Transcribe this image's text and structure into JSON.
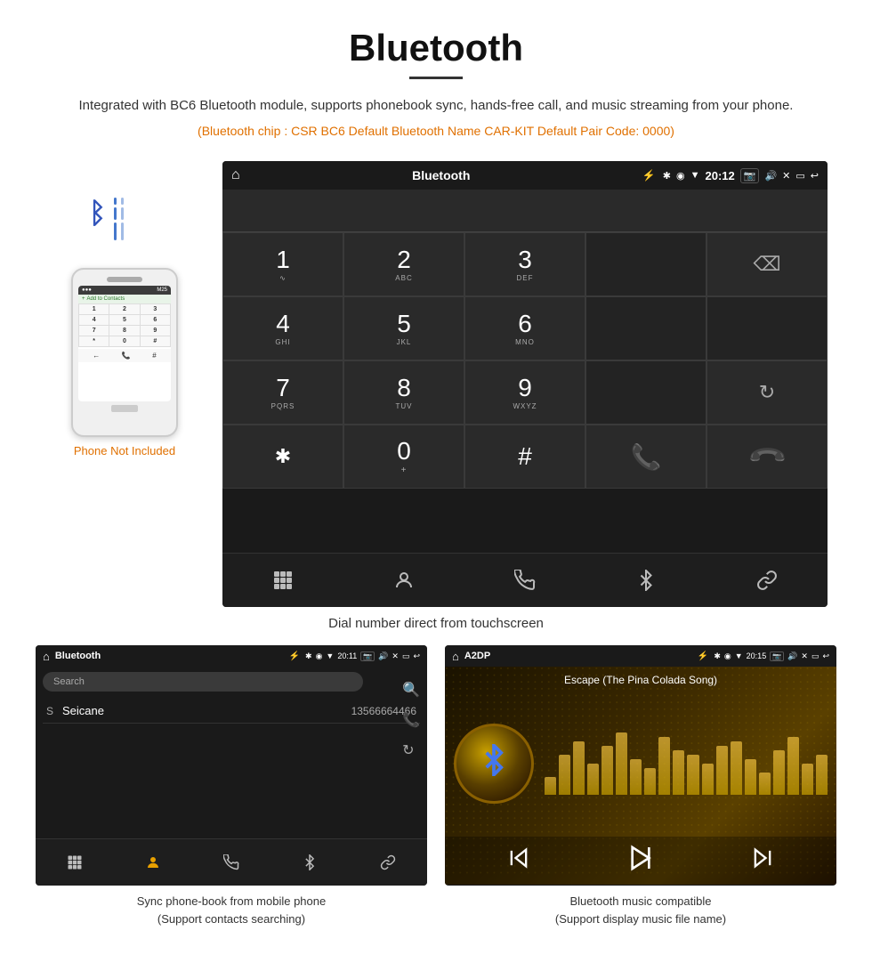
{
  "title": "Bluetooth",
  "description": "Integrated with BC6 Bluetooth module, supports phonebook sync, hands-free call, and music streaming from your phone.",
  "specs": "(Bluetooth chip : CSR BC6    Default Bluetooth Name CAR-KIT    Default Pair Code: 0000)",
  "phone_not_included": "Phone Not Included",
  "dial_caption": "Dial number direct from touchscreen",
  "statusbar": {
    "title": "Bluetooth",
    "time": "20:12"
  },
  "keypad": {
    "keys": [
      {
        "main": "1",
        "sub": ""
      },
      {
        "main": "2",
        "sub": "ABC"
      },
      {
        "main": "3",
        "sub": "DEF"
      },
      {
        "main": "",
        "sub": ""
      },
      {
        "main": "⌫",
        "sub": ""
      },
      {
        "main": "4",
        "sub": "GHI"
      },
      {
        "main": "5",
        "sub": "JKL"
      },
      {
        "main": "6",
        "sub": "MNO"
      },
      {
        "main": "",
        "sub": ""
      },
      {
        "main": "",
        "sub": ""
      },
      {
        "main": "7",
        "sub": "PQRS"
      },
      {
        "main": "8",
        "sub": "TUV"
      },
      {
        "main": "9",
        "sub": "WXYZ"
      },
      {
        "main": "",
        "sub": ""
      },
      {
        "main": "↻",
        "sub": ""
      },
      {
        "main": "✱",
        "sub": ""
      },
      {
        "main": "0",
        "sub": "+"
      },
      {
        "main": "#",
        "sub": ""
      },
      {
        "main": "✆",
        "sub": "green"
      },
      {
        "main": "✆",
        "sub": "red"
      }
    ]
  },
  "toolbar": {
    "icons": [
      "⊞",
      "👤",
      "✆",
      "✱",
      "🔗"
    ]
  },
  "phonebook_screen": {
    "statusbar_title": "Bluetooth",
    "statusbar_time": "20:11",
    "search_placeholder": "Search",
    "contact_letter": "S",
    "contact_name": "Seicane",
    "contact_number": "13566664466"
  },
  "music_screen": {
    "statusbar_title": "A2DP",
    "statusbar_time": "20:15",
    "song_title": "Escape (The Pina Colada Song)",
    "eq_bars": [
      20,
      45,
      60,
      35,
      55,
      70,
      40,
      30,
      65,
      50,
      45,
      35,
      55,
      60,
      40,
      25,
      50,
      65,
      35,
      45
    ]
  },
  "captions": {
    "phonebook": "Sync phone-book from mobile phone\n(Support contacts searching)",
    "music": "Bluetooth music compatible\n(Support display music file name)"
  }
}
